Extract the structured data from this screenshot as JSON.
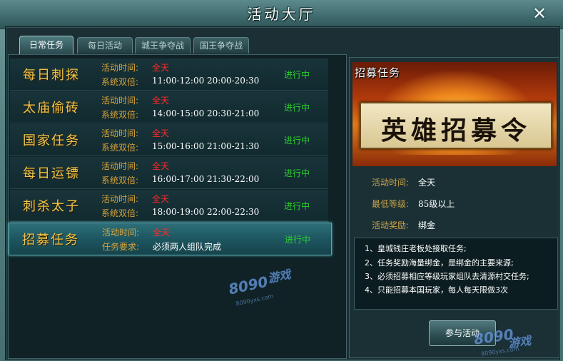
{
  "window": {
    "title": "活动大厅",
    "close_icon": "close-icon"
  },
  "tabs": [
    {
      "label": "日常任务",
      "active": true
    },
    {
      "label": "每日活动",
      "active": false
    },
    {
      "label": "城王争夺战",
      "active": false
    },
    {
      "label": "国王争夺战",
      "active": false
    }
  ],
  "activities": [
    {
      "name": "每日刺探",
      "line1_label": "活动时间:",
      "line1_value": "全天",
      "line2_label": "系统双倍:",
      "line2_value": "11:00-12:00 20:00-20:30",
      "status": "进行中"
    },
    {
      "name": "太庙偷砖",
      "line1_label": "活动时间:",
      "line1_value": "全天",
      "line2_label": "系统双倍:",
      "line2_value": "14:00-15:00 20:30-21:00",
      "status": "进行中"
    },
    {
      "name": "国家任务",
      "line1_label": "活动时间:",
      "line1_value": "全天",
      "line2_label": "系统双倍:",
      "line2_value": "15:00-16:00 21:00-21:30",
      "status": "进行中"
    },
    {
      "name": "每日运镖",
      "line1_label": "活动时间:",
      "line1_value": "全天",
      "line2_label": "系统双倍:",
      "line2_value": "16:00-17:00 21:30-22:00",
      "status": "进行中"
    },
    {
      "name": "刺杀太子",
      "line1_label": "活动时间:",
      "line1_value": "全天",
      "line2_label": "系统双倍:",
      "line2_value": "18:00-19:00 22:00-22:30",
      "status": "进行中"
    },
    {
      "name": "招募任务",
      "line1_label": "活动时间:",
      "line1_value": "全天",
      "line2_label": "任务要求:",
      "line2_value": "必须两人组队完成",
      "status": "进行中",
      "selected": true
    }
  ],
  "detail": {
    "banner_title": "招募任务",
    "banner_text": "英雄招募令",
    "time_label": "活动时间:",
    "time_value": "全天",
    "level_label": "最低等级:",
    "level_value": "85级以上",
    "reward_label": "活动奖励:",
    "reward_value": "绑金",
    "description": [
      "1、皇城钱庄老板处接取任务;",
      "2、任务奖励海量绑金，是绑金的主要来源;",
      "3、必须招募相应等级玩家组队去清源村交任务;",
      "4、只能招募本国玩家，每人每天限做3次"
    ],
    "join_button": "参与活动"
  },
  "watermark": {
    "text": "8090",
    "suffix": "游戏",
    "domain": "8090yxs.com"
  },
  "colors": {
    "activity_name": "#f0c44a",
    "label": "#d8a23a",
    "highlight_red": "#ff2a2a",
    "status_green": "#2cd12c",
    "selected_row": "#1d5660"
  }
}
